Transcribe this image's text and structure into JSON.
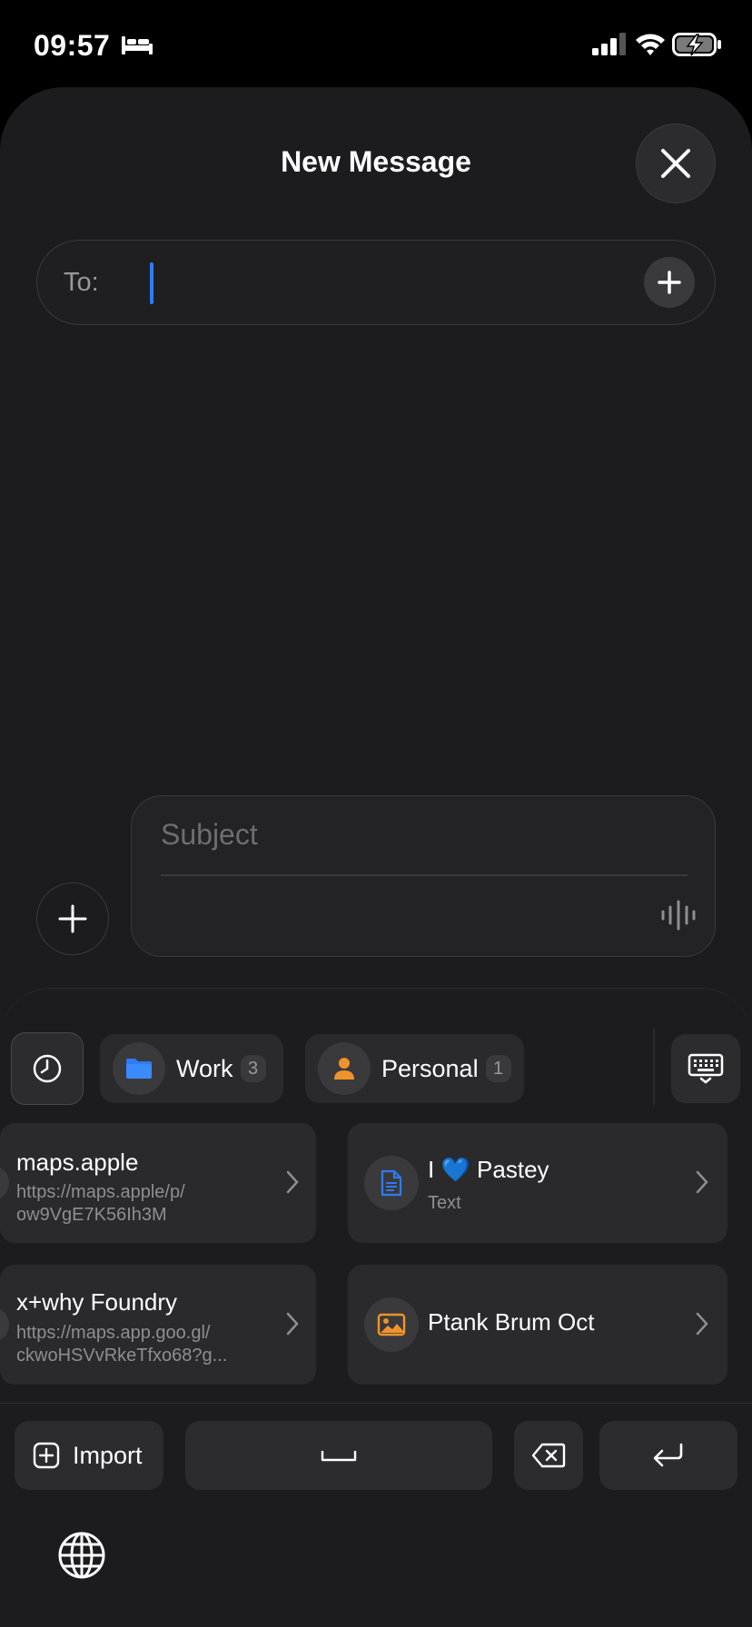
{
  "status_bar": {
    "time": "09:57",
    "icons": [
      "bed-icon",
      "cellular-signal-icon",
      "wifi-icon",
      "battery-charging-icon"
    ]
  },
  "compose": {
    "title": "New Message",
    "close_icon": "close-icon",
    "to_label": "To:",
    "to_value": "",
    "add_recipient_icon": "plus-icon",
    "subject_placeholder": "Subject",
    "attach_icon": "plus-icon",
    "dictation_icon": "waveform-icon"
  },
  "clipboard_keyboard": {
    "history_icon": "clock-icon",
    "folders": [
      {
        "label": "Work",
        "count": "3",
        "icon": "folder-icon",
        "color": "#2f7bf5"
      },
      {
        "label": "Personal",
        "count": "1",
        "icon": "person-icon",
        "color": "#f0932b"
      }
    ],
    "keyboard_switch_icon": "keyboard-icon",
    "items": [
      {
        "title": "maps.apple",
        "subtitle_1": "https://maps.apple/p/",
        "subtitle_2": "ow9VgE7K56Ih3M"
      },
      {
        "title": "I 💙 Pastey",
        "subtitle_1": "Text",
        "icon": "document-icon"
      },
      {
        "title": "x+why Foundry",
        "subtitle_1": "https://maps.app.goo.gl/",
        "subtitle_2": "ckwoHSVvRkeTfxo68?g..."
      },
      {
        "title": "Ptank Brum Oct",
        "icon": "photo-icon"
      }
    ],
    "import_label": "Import",
    "accent_blue": "#2f7bf5",
    "accent_orange": "#f0932b"
  }
}
